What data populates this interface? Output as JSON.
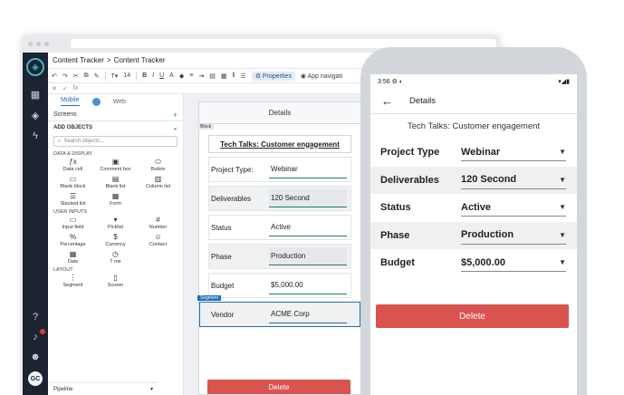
{
  "app": {
    "breadcrumb": [
      "Content Tracker",
      "Content Tracker"
    ],
    "breadcrumb_sep": ">",
    "toolbar": {
      "font_size": "14",
      "bold": "B",
      "italic": "I",
      "underline": "U",
      "font_color": "A",
      "properties": "Properties",
      "app_navigation": "App navigati"
    },
    "fx": "fx"
  },
  "panel": {
    "tabs": [
      "Mobile",
      "Web"
    ],
    "screens_label": "Screens",
    "add_label": "+",
    "add_objects": "ADD OBJECTS",
    "search_placeholder": "Search objects...",
    "sections": {
      "data_display": "DATA & DISPLAY",
      "user_inputs": "USER INPUTS",
      "layout": "LAYOUT"
    },
    "data_display_items": [
      {
        "label": "Data cell",
        "icon": "fx-icon"
      },
      {
        "label": "Comment box",
        "icon": "comment-box-icon"
      },
      {
        "label": "Button",
        "icon": "button-icon"
      },
      {
        "label": "Blank block",
        "icon": "blank-block-icon"
      },
      {
        "label": "Blank list",
        "icon": "blank-list-icon"
      },
      {
        "label": "Column list",
        "icon": "column-list-icon"
      },
      {
        "label": "Stacked list",
        "icon": "stacked-list-icon"
      },
      {
        "label": "Form",
        "icon": "form-icon"
      }
    ],
    "user_input_items": [
      {
        "label": "Input field",
        "icon": "input-field-icon"
      },
      {
        "label": "Picklist",
        "icon": "picklist-icon"
      },
      {
        "label": "Number",
        "icon": "number-icon"
      },
      {
        "label": "Percentage",
        "icon": "percentage-icon"
      },
      {
        "label": "Currency",
        "icon": "currency-icon"
      },
      {
        "label": "Contact",
        "icon": "contact-icon"
      },
      {
        "label": "Date",
        "icon": "date-icon"
      },
      {
        "label": "T me",
        "icon": "time-icon"
      }
    ],
    "layout_items": [
      {
        "label": "Segment",
        "icon": "segment-icon"
      },
      {
        "label": "Screen",
        "icon": "screen-icon"
      }
    ],
    "pipeline": "Pipeline"
  },
  "canvas": {
    "header": "Details",
    "block_tag": "Block",
    "title": "Tech Talks: Customer engagement",
    "segment_tag": "Segment",
    "rows": [
      {
        "label": "Project Type:",
        "value": "Webinar"
      },
      {
        "label": "Deliverables",
        "value": "120 Second"
      },
      {
        "label": "Status",
        "value": "Active"
      },
      {
        "label": "Phase",
        "value": "Production"
      },
      {
        "label": "Budget",
        "value": "$5,000.00"
      },
      {
        "label": "Vendor",
        "value": "ACME Corp"
      }
    ],
    "delete": "Delete"
  },
  "phone": {
    "time": "3:56",
    "screen_title": "Details",
    "title": "Tech Talks: Customer engagement",
    "rows": [
      {
        "label": "Project Type",
        "value": "Webinar"
      },
      {
        "label": "Deliverables",
        "value": "120 Second"
      },
      {
        "label": "Status",
        "value": "Active"
      },
      {
        "label": "Phase",
        "value": "Production"
      },
      {
        "label": "Budget",
        "value": "$5,000.00"
      }
    ],
    "delete": "Delete"
  },
  "rail": {
    "avatar": "GC"
  },
  "colors": {
    "rail": "#1b2430",
    "accent": "#1b6fb8",
    "delete": "#d9534f",
    "underline": "#1d7a6c"
  }
}
